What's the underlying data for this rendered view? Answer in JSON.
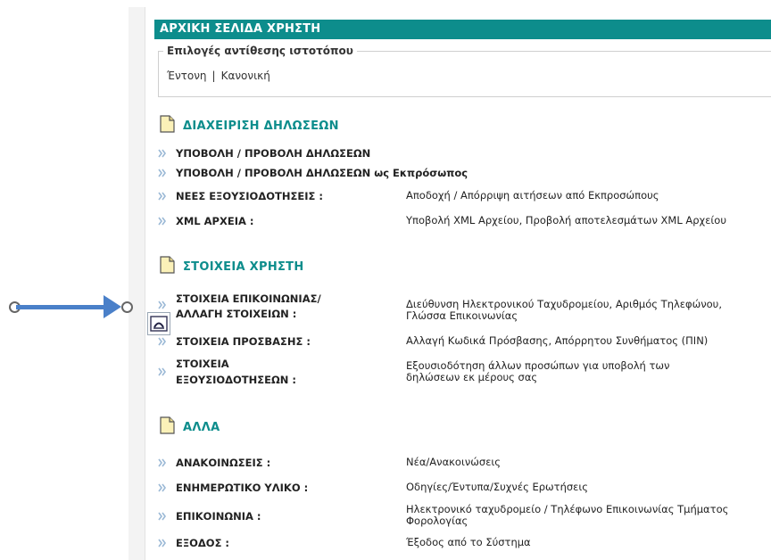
{
  "colors": {
    "accent": "#0d8d8c",
    "arrow_blue": "#4a80c9",
    "bullet": "#9bb9d6"
  },
  "header": {
    "title": "ΑΡΧΙΚΗ ΣΕΛΙΔΑ ΧΡΗΣΤΗ"
  },
  "contrast": {
    "legend": "Επιλογές αντίθεσης ιστοτόπου",
    "options": [
      "Έντονη",
      "Κανονική"
    ],
    "separator": "|"
  },
  "sections": [
    {
      "title": "ΔΙΑΧΕΙΡΙΣΗ ΔΗΛΩΣΕΩΝ",
      "items": [
        {
          "label": "ΥΠΟΒΟΛΗ / ΠΡΟΒΟΛΗ ΔΗΛΩΣΕΩΝ",
          "desc": ""
        },
        {
          "label": "ΥΠΟΒΟΛΗ / ΠΡΟΒΟΛΗ ΔΗΛΩΣΕΩΝ ως Εκπρόσωπος",
          "desc": ""
        },
        {
          "label": "ΝΕΕΣ ΕΞΟΥΣΙΟΔΟΤΗΣΕΙΣ :",
          "desc": "Αποδοχή / Απόρριψη αιτήσεων από Εκπροσώπους"
        },
        {
          "label": "XML ΑΡΧΕΙΑ :",
          "desc": "Υποβολή XML Αρχείου, Προβολή αποτελεσμάτων XML Αρχείου"
        }
      ]
    },
    {
      "title": "ΣΤΟΙΧΕΙΑ ΧΡΗΣΤΗ",
      "items": [
        {
          "label_line1": "ΣΤΟΙΧΕΙΑ ΕΠΙΚΟΙΝΩΝΙΑΣ/",
          "label_line2": "ΑΛΛΑΓΗ ΣΤΟΙΧΕΙΩΝ :",
          "desc_line1": "Διεύθυνση Ηλεκτρονικού Ταχυδρομείου, Αριθμός Τηλεφώνου,",
          "desc_line2": "Γλώσσα Επικοινωνίας"
        },
        {
          "label": "ΣΤΟΙΧΕΙΑ ΠΡΟΣΒΑΣΗΣ :",
          "desc": "Αλλαγή Κωδικά Πρόσβασης, Απόρρητου Συνθήματος (ΠΙΝ)"
        },
        {
          "label_line1": "ΣΤΟΙΧΕΙΑ",
          "label_line2": "ΕΞΟΥΣΙΟΔΟΤΗΣΕΩΝ :",
          "desc_line1": "Εξουσιοδότηση άλλων προσώπων για υποβολή των",
          "desc_line2": "δηλώσεων εκ μέρους σας"
        }
      ]
    },
    {
      "title": "ΑΛΛΑ",
      "items": [
        {
          "label": "ΑΝΑΚΟΙΝΩΣΕΙΣ :",
          "desc": "Νέα/Ανακοινώσεις"
        },
        {
          "label": "ΕΝΗΜΕΡΩΤΙΚΟ ΥΛΙΚΟ :",
          "desc": "Οδηγίες/Έντυπα/Συχνές Ερωτήσεις"
        },
        {
          "label": "ΕΠΙΚΟΙΝΩΝΙΑ :",
          "desc_line1": "Ηλεκτρονικό ταχυδρομείο / Τηλέφωνο Επικοινωνίας Τμήματος",
          "desc_line2": "Φορολογίας"
        },
        {
          "label": "ΕΞΟΔΟΣ :",
          "desc": "Έξοδος από το Σύστημα"
        }
      ]
    }
  ],
  "icons": {
    "section": "document-icon",
    "bullet": "double-chevron-right-icon",
    "annotation": "arrow-right-icon",
    "accessibility": "accessibility-icon"
  }
}
